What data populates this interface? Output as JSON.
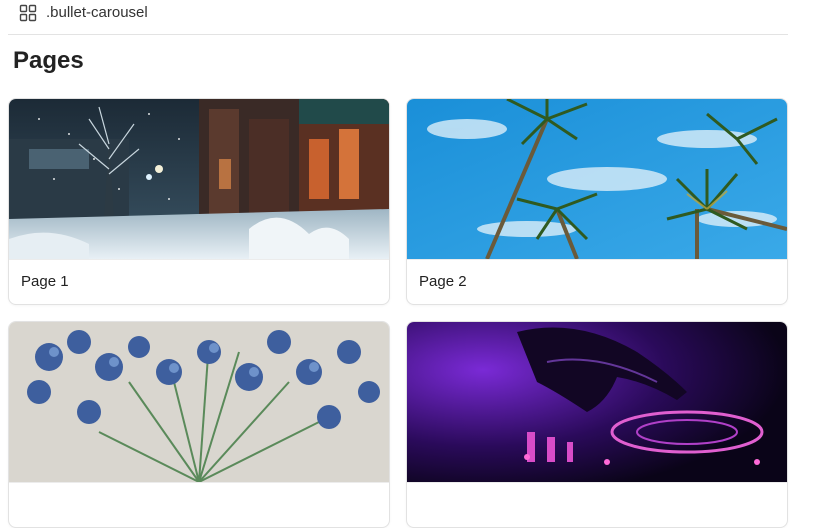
{
  "breadcrumb": {
    "icon": "grid-icon",
    "label": ".bullet-carousel"
  },
  "heading": "Pages",
  "pages": [
    {
      "label": "Page 1",
      "image": "snowy-city-street-at-night"
    },
    {
      "label": "Page 2",
      "image": "palm-trees-blue-sky"
    },
    {
      "label": "",
      "image": "blue-irises-painting"
    },
    {
      "label": "",
      "image": "dj-turntable-purple-light"
    }
  ]
}
